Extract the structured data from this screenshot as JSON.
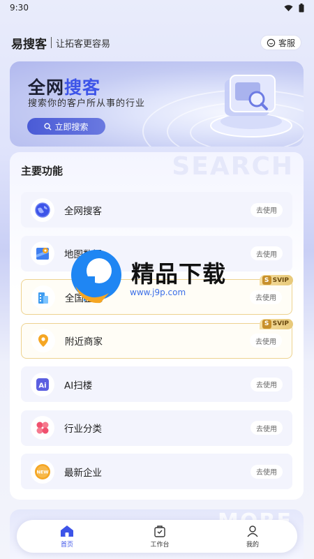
{
  "status": {
    "time": "9:30"
  },
  "header": {
    "brand": "易搜客",
    "slogan": "让拓客更容易",
    "service_label": "客服"
  },
  "banner": {
    "title_part1": "全网",
    "title_part2": "搜客",
    "subtitle": "搜索你的客户所从事的行业",
    "button_label": "立即搜索"
  },
  "main": {
    "section_title": "主要功能",
    "watermark": "SEARCH",
    "features": [
      {
        "label": "全网搜客",
        "action": "去使用",
        "icon": "globe-icon",
        "vip": false
      },
      {
        "label": "地图数据",
        "action": "去使用",
        "icon": "map-pin-icon",
        "vip": false
      },
      {
        "label": "全国企业",
        "action": "去使用",
        "icon": "building-icon",
        "vip": true,
        "badge": "SVIP"
      },
      {
        "label": "附近商家",
        "action": "去使用",
        "icon": "location-icon",
        "vip": true,
        "badge": "SVIP"
      },
      {
        "label": "AI扫楼",
        "action": "去使用",
        "icon": "ai-icon",
        "vip": false
      },
      {
        "label": "行业分类",
        "action": "去使用",
        "icon": "category-icon",
        "vip": false
      },
      {
        "label": "最新企业",
        "action": "去使用",
        "icon": "new-icon",
        "vip": false
      }
    ]
  },
  "more": {
    "watermark": "MORE"
  },
  "tabbar": {
    "items": [
      {
        "label": "首页"
      },
      {
        "label": "工作台"
      },
      {
        "label": "我的"
      }
    ]
  },
  "overlay": {
    "text": "精品下载",
    "url": "www.j9p.com"
  },
  "colors": {
    "accent": "#3d54e8",
    "vip_gold": "#e7c878"
  }
}
